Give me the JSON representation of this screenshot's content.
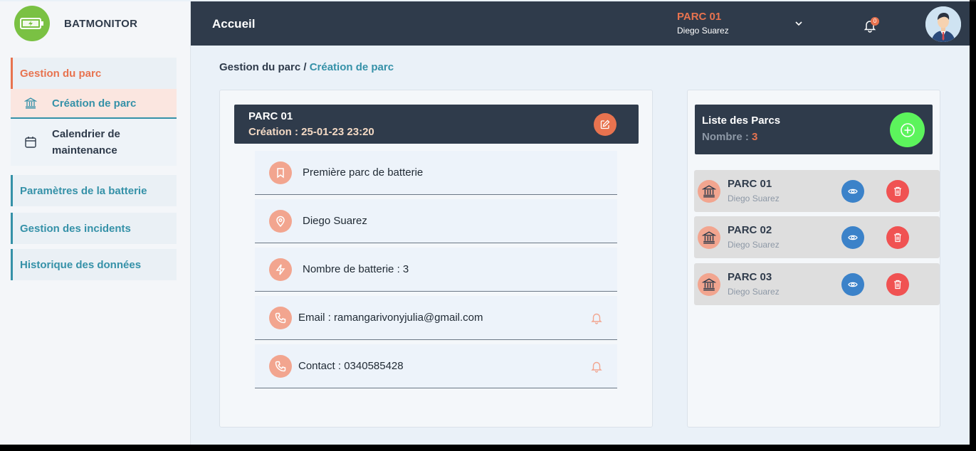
{
  "brand": {
    "name": "BATMONITOR",
    "logo_icon": "battery-icon",
    "accent": "#7ac143"
  },
  "sidebar": {
    "group_title": "Gestion du parc",
    "sub_items": [
      {
        "label": "Création de parc",
        "icon": "bank-icon",
        "active": true
      },
      {
        "label": "Calendrier de maintenance",
        "icon": "calendar-icon",
        "active": false
      }
    ],
    "items": [
      {
        "label": "Paramètres de la batterie"
      },
      {
        "label": "Gestion des incidents"
      },
      {
        "label": "Historique des données"
      }
    ]
  },
  "header": {
    "title": "Accueil",
    "parc_name": "PARC 01",
    "parc_user": "Diego Suarez",
    "notification_count": "0"
  },
  "breadcrumb": {
    "root": "Gestion du parc /",
    "current": "Création de parc"
  },
  "detail": {
    "title": "PARC 01",
    "subtitle": "Création : 25-01-23 23:20",
    "rows": [
      {
        "icon": "bookmark-icon",
        "text": "Première parc de batterie"
      },
      {
        "icon": "location-pin-icon",
        "text": "Diego Suarez"
      },
      {
        "icon": "lightning-icon",
        "text": "Nombre de batterie : 3"
      },
      {
        "icon": "phone-icon",
        "text": "Email : ramangarivonyjulia@gmail.com",
        "bell": true
      },
      {
        "icon": "phone-icon",
        "text": "Contact : 0340585428",
        "bell": true
      }
    ]
  },
  "list": {
    "title": "Liste des Parcs",
    "count_label": "Nombre :",
    "count": "3",
    "items": [
      {
        "name": "PARC 01",
        "user": "Diego Suarez"
      },
      {
        "name": "PARC 02",
        "user": "Diego Suarez"
      },
      {
        "name": "PARC 03",
        "user": "Diego Suarez"
      }
    ]
  },
  "colors": {
    "navy": "#2f3b4b",
    "orange": "#e8734f",
    "teal": "#3591a8",
    "salmon": "#f2a58f",
    "green": "#5cf45c",
    "blue": "#3b82c9",
    "red": "#f05252"
  }
}
